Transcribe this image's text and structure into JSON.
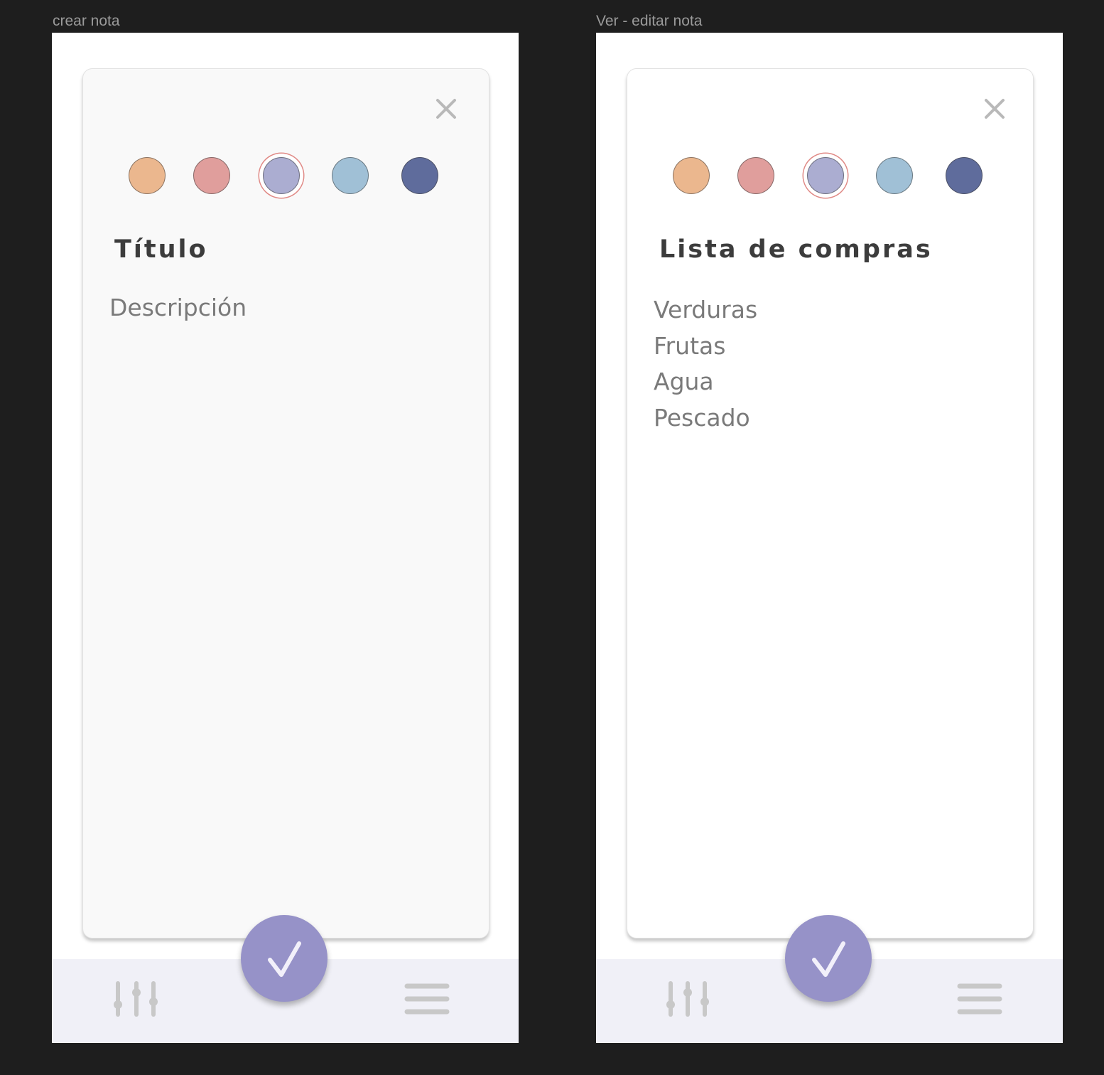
{
  "screens": [
    {
      "frame_label": "crear nota",
      "card_bg": "#f9f9f9",
      "title": "Título",
      "description_placeholder": "Descripción",
      "close_icon": "close-icon",
      "colors": [
        {
          "name": "orange",
          "hex": "#ebb78e",
          "selected": false
        },
        {
          "name": "pink",
          "hex": "#e09e9c",
          "selected": false
        },
        {
          "name": "lavender",
          "hex": "#abadd1",
          "selected": true
        },
        {
          "name": "light-blue",
          "hex": "#a0c0d6",
          "selected": false
        },
        {
          "name": "navy",
          "hex": "#5f6c9c",
          "selected": false
        }
      ]
    },
    {
      "frame_label": "Ver - editar nota",
      "card_bg": "#ffffff",
      "title": "Lista de compras",
      "items": [
        "Verduras",
        "Frutas",
        "Agua",
        "Pescado"
      ],
      "close_icon": "close-icon",
      "colors": [
        {
          "name": "orange",
          "hex": "#ebb78e",
          "selected": false
        },
        {
          "name": "pink",
          "hex": "#e09e9c",
          "selected": false
        },
        {
          "name": "lavender",
          "hex": "#abadd1",
          "selected": true
        },
        {
          "name": "light-blue",
          "hex": "#a0c0d6",
          "selected": false
        },
        {
          "name": "navy",
          "hex": "#5f6c9c",
          "selected": false
        }
      ]
    }
  ],
  "bottom_bar": {
    "bg": "#f0f0f7",
    "left_icon": "filter-sliders-icon",
    "right_icon": "menu-icon"
  },
  "fab": {
    "icon": "check-icon",
    "color": "#9692c8"
  }
}
